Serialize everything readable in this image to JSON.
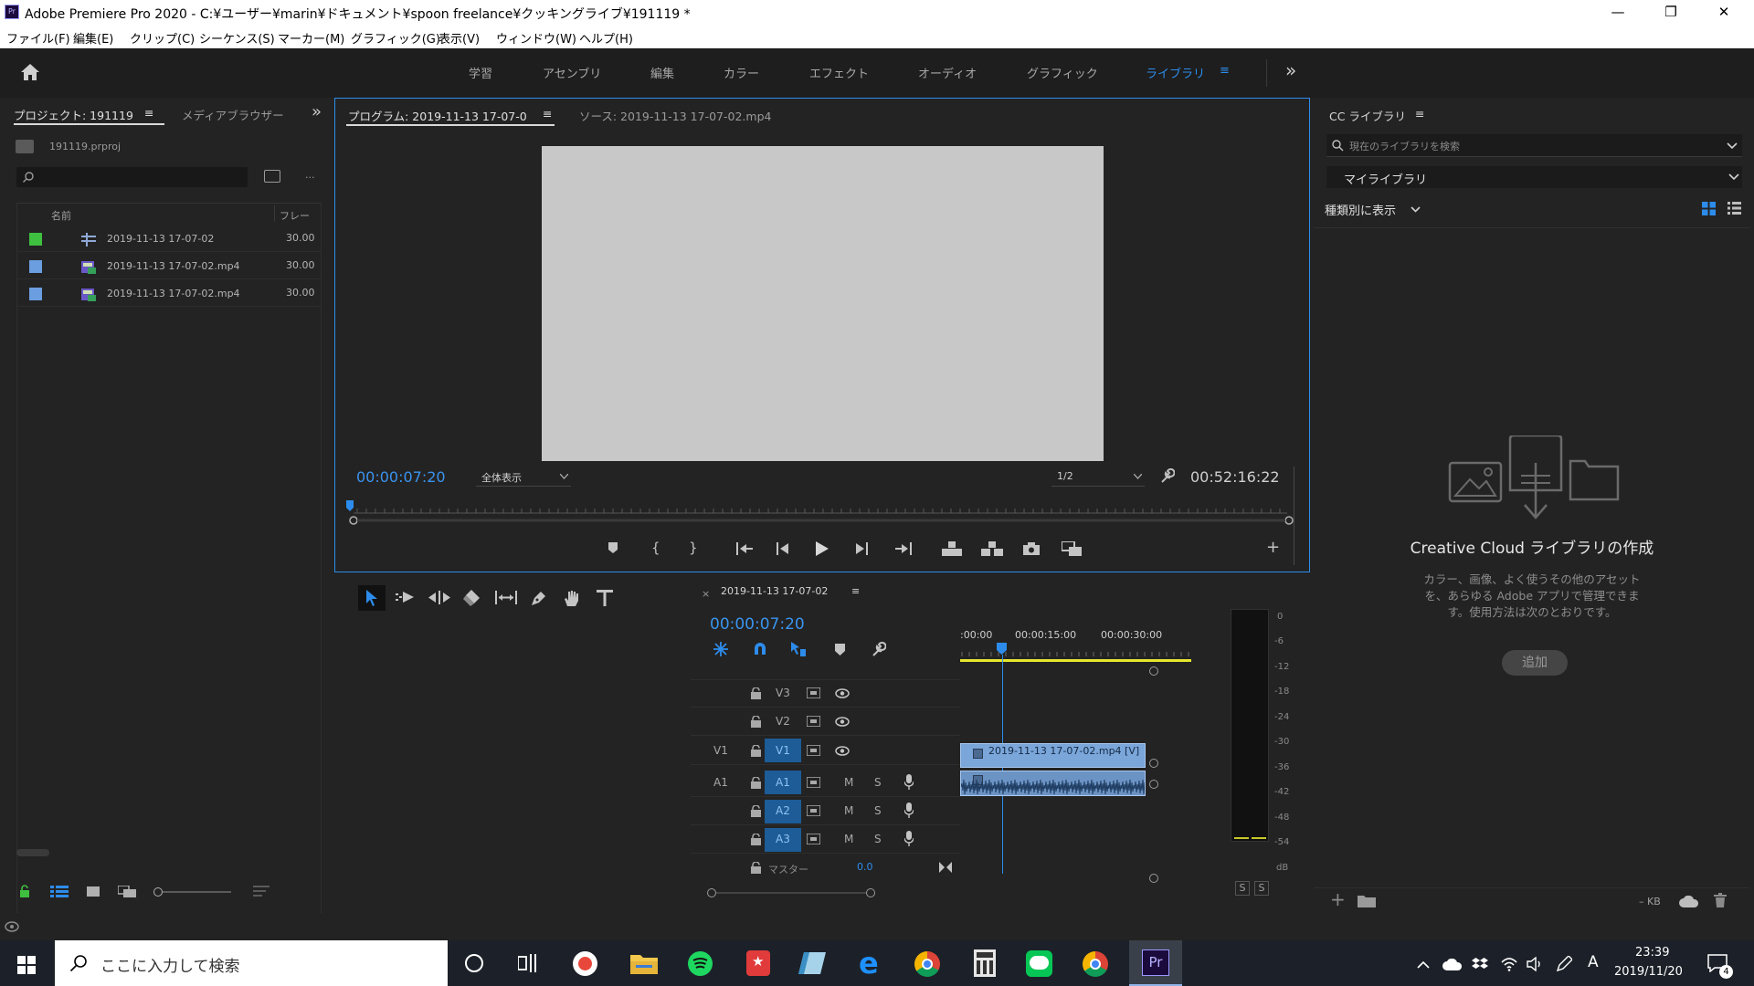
{
  "window": {
    "title": "Adobe Premiere Pro 2020 - C:¥ユーザー¥marin¥ドキュメント¥spoon freelance¥クッキングライブ¥191119 *",
    "app_icon_text": "Pr",
    "minimize": "—",
    "maximize": "❐",
    "close": "✕"
  },
  "menu": [
    "ファイル(F)",
    "編集(E)",
    "クリップ(C)",
    "シーケンス(S)",
    "マーカー(M)",
    "グラフィック(G)",
    "表示(V)",
    "ウィンドウ(W)",
    "ヘルプ(H)"
  ],
  "workspaces": {
    "tabs": [
      "学習",
      "アセンブリ",
      "編集",
      "カラー",
      "エフェクト",
      "オーディオ",
      "グラフィック",
      "ライブラリ"
    ],
    "active": "ライブラリ",
    "menu_icon": "≡",
    "overflow": "»"
  },
  "project_panel": {
    "tab_label": "プロジェクト: 191119",
    "tab_menu": "≡",
    "media_browser_label": "メディアブラウザー",
    "overflow": "»",
    "project_file": "191119.prproj",
    "search_placeholder": "",
    "more": "...",
    "col_name": "名前",
    "col_frame": "フレー",
    "items": [
      {
        "name": "2019-11-13 17-07-02",
        "frame": "30.00",
        "color": "#3fbf3f",
        "kind": "sequence"
      },
      {
        "name": "2019-11-13 17-07-02.mp4",
        "frame": "30.00",
        "color": "#6b9ee0",
        "kind": "clip"
      },
      {
        "name": "2019-11-13 17-07-02.mp4",
        "frame": "30.00",
        "color": "#6b9ee0",
        "kind": "clip"
      }
    ]
  },
  "program_monitor": {
    "tab_label": "プログラム: 2019-11-13 17-07-0",
    "tab_menu": "≡",
    "source_label": "ソース: 2019-11-13 17-07-02.mp4",
    "timecode": "00:00:07:20",
    "fit_label": "全体表示",
    "resolution": "1/2",
    "duration": "00:52:16:22",
    "add": "+"
  },
  "library_panel": {
    "tab_label": "CC ライブラリ",
    "tab_menu": "≡",
    "search_placeholder": "現在のライブラリを検索",
    "library_select": "マイライブラリ",
    "view_by": "種類別に表示",
    "empty_title": "Creative Cloud ライブラリの作成",
    "empty_body_1": "カラー、画像、よく使うその他のアセット",
    "empty_body_2": "を、あらゆる Adobe アプリで管理できま",
    "empty_body_3": "す。使用方法は次のとおりです。",
    "add_button": "追加",
    "size": "– KB"
  },
  "timeline": {
    "close": "×",
    "sequence_name": "2019-11-13 17-07-02",
    "menu": "≡",
    "timecode": "00:00:07:20",
    "ruler": [
      ":00:00",
      "00:00:15:00",
      "00:00:30:00"
    ],
    "tracks_video": [
      {
        "src": "",
        "name": "V3"
      },
      {
        "src": "",
        "name": "V2"
      },
      {
        "src": "V1",
        "name": "V1"
      }
    ],
    "tracks_audio": [
      {
        "src": "A1",
        "name": "A1"
      },
      {
        "src": "",
        "name": "A2"
      },
      {
        "src": "",
        "name": "A3"
      }
    ],
    "mute": "M",
    "solo": "S",
    "master_label": "マスター",
    "master_value": "0.0",
    "video_clip": "2019-11-13 17-07-02.mp4 [V]"
  },
  "audio_meter": {
    "scale": [
      "0",
      "-6",
      "-12",
      "-18",
      "-24",
      "-30",
      "-36",
      "-42",
      "-48",
      "-54",
      "dB"
    ],
    "solo_left": "S",
    "solo_right": "S"
  },
  "taskbar": {
    "search_placeholder": "ここに入力して検索",
    "time": "23:39",
    "date": "2019/11/20",
    "ime": "A",
    "notif_count": "4"
  },
  "colors": {
    "accent": "#2d8ceb",
    "timecode_blue": "#3a93ee",
    "clip_blue": "#7aa6da",
    "yellow": "#e6e62e"
  }
}
